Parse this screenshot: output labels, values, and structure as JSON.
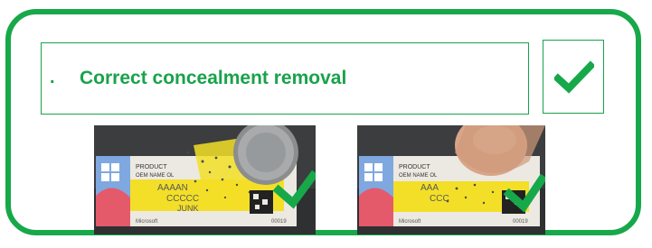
{
  "caption": {
    "bullet": ".",
    "text": "Correct concealment removal"
  },
  "icons": {
    "result_check": "check-icon",
    "photo_check": "check-icon",
    "coin": "coin-icon",
    "fingertip": "fingertip-icon"
  },
  "colors": {
    "accent_green": "#17a84a",
    "label_yellow": "#f3df27",
    "label_blue": "#7fa8e0",
    "background_dark": "#3b3d3f"
  },
  "photos": [
    {
      "label_text": {
        "line1": "PRODUCT",
        "line2": "OEM NAME OL",
        "line3": "AAAAN",
        "line4": "CCCCC",
        "line5": "JUNK",
        "brand": "Microsoft",
        "serial": "00019"
      }
    },
    {
      "label_text": {
        "line1": "PRODUCT",
        "line2": "OEM NAME OL",
        "line3": "AAA",
        "line4": "CCC",
        "line5": "",
        "brand": "Microsoft",
        "serial": "00019"
      }
    }
  ]
}
